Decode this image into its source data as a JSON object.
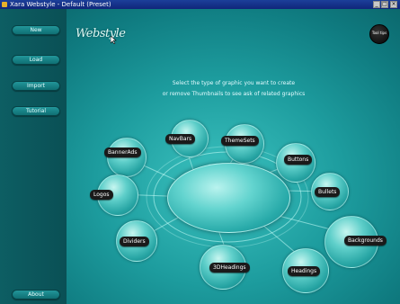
{
  "window": {
    "title": "Xara Webstyle - Default (Preset)",
    "controls": {
      "minimize": "_",
      "maximize": "□",
      "close": "×"
    }
  },
  "sidebar": {
    "items": [
      {
        "label": "New"
      },
      {
        "label": "Load"
      },
      {
        "label": "Import"
      },
      {
        "label": "Tutorial"
      },
      {
        "label": "About"
      }
    ]
  },
  "header": {
    "logo": "Webstyle",
    "help_button": "Tool tips"
  },
  "main": {
    "instruction_line1": "Select the type of graphic you want to create",
    "instruction_line2": "or remove Thumbnails to see ask of related graphics",
    "categories": [
      {
        "label": "NavBars"
      },
      {
        "label": "ThemeSets"
      },
      {
        "label": "Buttons"
      },
      {
        "label": "BannerAds"
      },
      {
        "label": "Bullets"
      },
      {
        "label": "Logos"
      },
      {
        "label": "Backgrounds"
      },
      {
        "label": "Dividers"
      },
      {
        "label": "3DHeadings"
      },
      {
        "label": "Headings"
      }
    ]
  },
  "colors": {
    "accent": "#1d9c9e",
    "sidebar": "#0a5055",
    "pill": "#1a1a1a",
    "titlebar": "#10267a"
  },
  "icons": {
    "help": "help-icon",
    "app": "app-icon",
    "cursor": "cursor-icon"
  }
}
